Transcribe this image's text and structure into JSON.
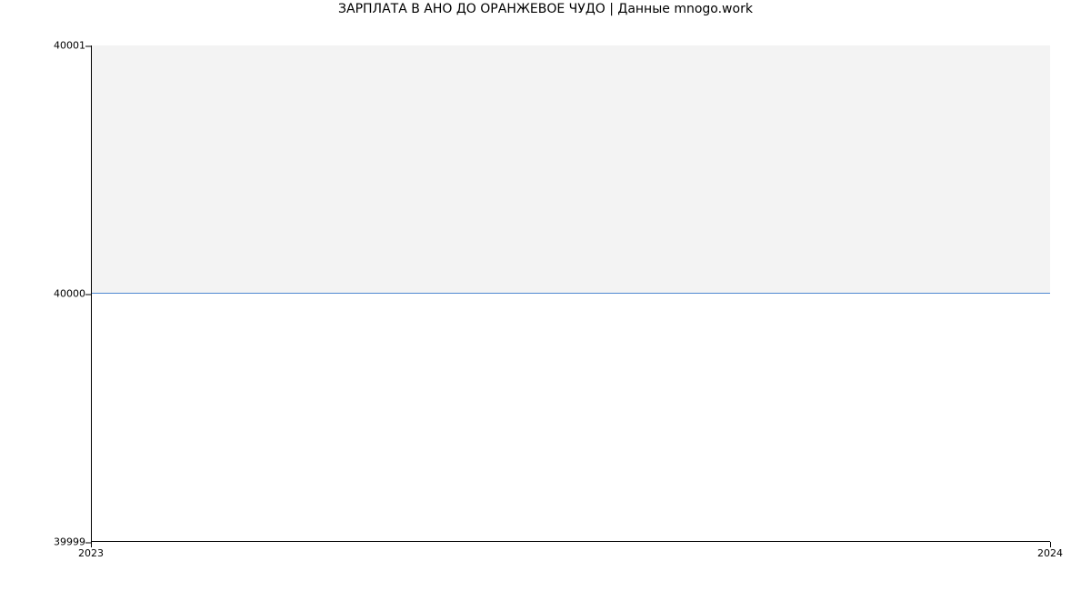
{
  "chart_data": {
    "type": "area",
    "title": "ЗАРПЛАТА В АНО ДО ОРАНЖЕВОЕ ЧУДО | Данные mnogo.work",
    "xlabel": "",
    "ylabel": "",
    "x_ticks": [
      "2023",
      "2024"
    ],
    "y_ticks": [
      "39999",
      "40000",
      "40001"
    ],
    "xlim": [
      2023,
      2024
    ],
    "ylim": [
      39999,
      40001
    ],
    "x": [
      2023,
      2024
    ],
    "values": [
      40000,
      40000
    ],
    "line_color": "#4f88d1",
    "fill_color": "#f3f3f3"
  }
}
